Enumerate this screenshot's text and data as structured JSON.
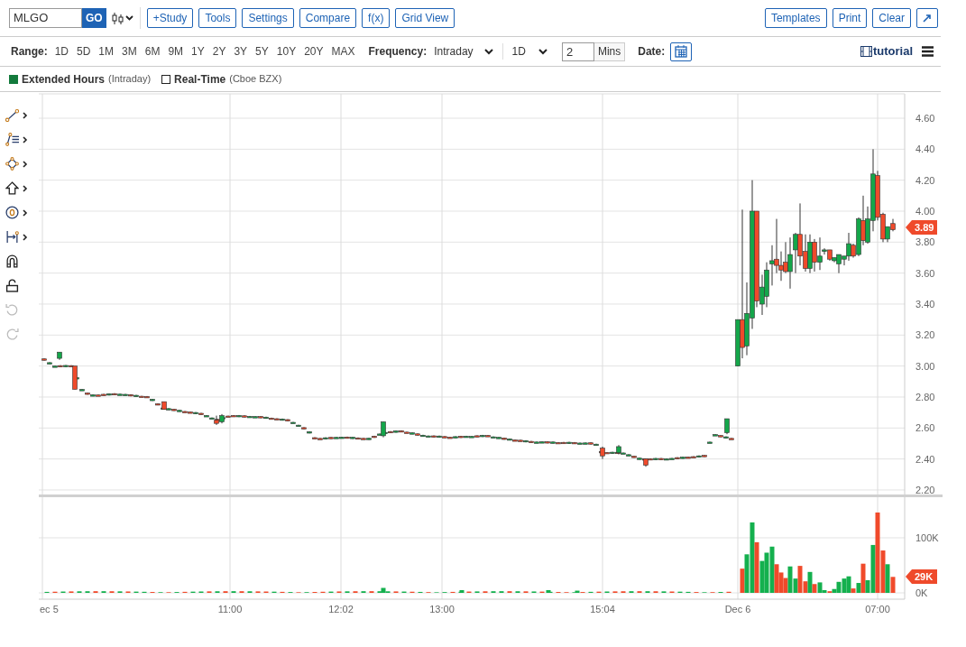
{
  "toolbar": {
    "symbol": "MLGO",
    "go_button": "GO",
    "buttons": [
      "+Study",
      "Tools",
      "Settings",
      "Compare",
      "f(x)",
      "Grid View"
    ],
    "right_buttons": [
      "Templates",
      "Print",
      "Clear"
    ]
  },
  "range_bar": {
    "range_label": "Range:",
    "ranges": [
      "1D",
      "5D",
      "1M",
      "3M",
      "6M",
      "9M",
      "1Y",
      "2Y",
      "3Y",
      "5Y",
      "10Y",
      "20Y",
      "MAX"
    ],
    "frequency_label": "Frequency:",
    "frequency": "Intraday",
    "period": "1D",
    "interval": "2",
    "interval_unit": "Mins",
    "date_label": "Date:",
    "tutorial": "tutorial"
  },
  "legend": [
    {
      "label": "Extended Hours",
      "note": "(Intraday)",
      "checked": true
    },
    {
      "label": "Real-Time",
      "note": "(Cboe BZX)",
      "checked": false
    }
  ],
  "tool_palette": {
    "undo": {
      "disabled": true
    },
    "redo": {
      "disabled": true
    }
  },
  "chart": {
    "price_ticks": [
      "4.60",
      "4.40",
      "4.20",
      "4.00",
      "3.80",
      "3.60",
      "3.40",
      "3.20",
      "3.00",
      "2.80",
      "2.60",
      "2.40",
      "2.20"
    ],
    "price_tag": "3.89",
    "volume_ticks": [
      "100K",
      "0K"
    ],
    "volume_tag": "29K",
    "time_labels": [
      "ec 5",
      "11:00",
      "12:02",
      "13:00",
      "15:04",
      "Dec 6",
      "07:00"
    ]
  }
}
